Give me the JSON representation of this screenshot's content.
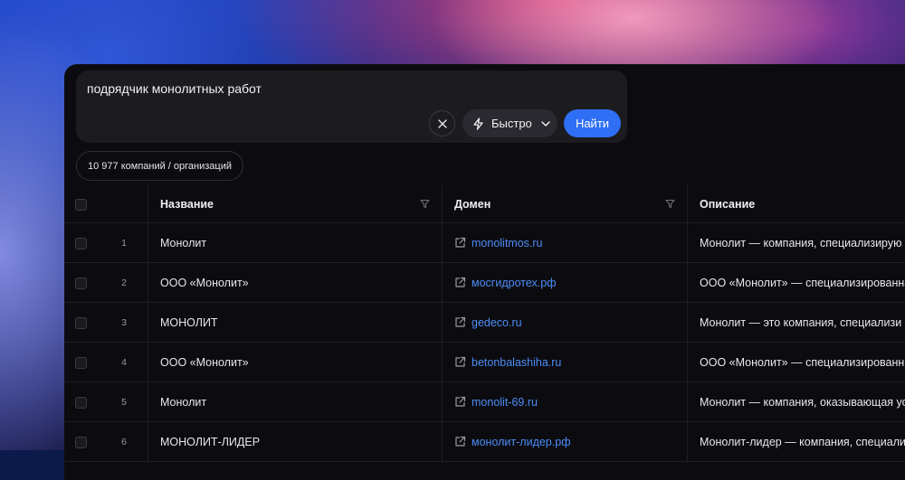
{
  "search": {
    "query": "подрядчик монолитных работ",
    "mode_label": "Быстро",
    "submit_label": "Найти"
  },
  "results_count": "10 977 компаний / организаций",
  "table": {
    "columns": [
      "Название",
      "Домен",
      "Описание"
    ],
    "rows": [
      {
        "num": "1",
        "name": "Монолит",
        "domain": "monolitmos.ru",
        "desc": "Монолит — компания, специализирую"
      },
      {
        "num": "2",
        "name": "ООО «Монолит»",
        "domain": "мосгидротех.рф",
        "desc": "ООО «Монолит» — специализированна"
      },
      {
        "num": "3",
        "name": "МОНОЛИТ",
        "domain": "gedeco.ru",
        "desc": "Монолит — это компания, специализи"
      },
      {
        "num": "4",
        "name": "ООО «Монолит»",
        "domain": "betonbalashiha.ru",
        "desc": "ООО «Монолит» — специализированн"
      },
      {
        "num": "5",
        "name": "Монолит",
        "domain": "monolit-69.ru",
        "desc": "Монолит — компания, оказывающая усл"
      },
      {
        "num": "6",
        "name": "МОНОЛИТ-ЛИДЕР",
        "domain": "монолит-лидер.рф",
        "desc": "Монолит-лидер — компания, специализ"
      }
    ]
  },
  "colors": {
    "accent": "#2f6ff5",
    "link": "#4c8df6",
    "panel_bg": "#0c0c10"
  },
  "icons": {
    "clear": "close-icon",
    "mode": "lightning-icon",
    "dropdown": "chevron-down-icon",
    "filter": "filter-icon",
    "external": "external-link-icon"
  }
}
